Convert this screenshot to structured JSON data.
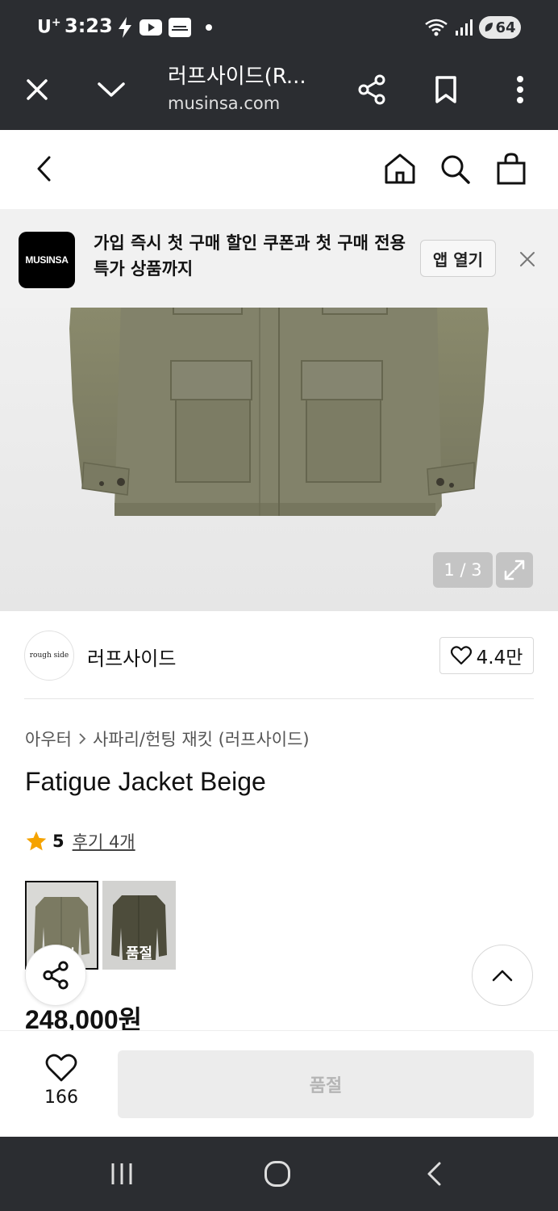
{
  "status_bar": {
    "carrier": "U",
    "carrier_sup": "+",
    "time": "3:23",
    "battery": "64",
    "icons": [
      "charging-icon",
      "youtube-icon",
      "app-icon",
      "wifi-icon",
      "signal-icon"
    ]
  },
  "browser": {
    "title": "러프사이드(R...",
    "url": "musinsa.com"
  },
  "banner": {
    "logo_text": "MUSINSA",
    "message": "가입 즉시 첫 구매 할인 쿠폰과 첫 구매 전용 특가 상품까지",
    "open_app_label": "앱 열기"
  },
  "gallery": {
    "counter": "1 / 3"
  },
  "brand": {
    "logo_text": "rough side",
    "name": "러프사이드",
    "likes": "4.4만"
  },
  "product": {
    "breadcrumb": [
      "아우터",
      "사파리/헌팅 재킷 (러프사이드)"
    ],
    "title": "Fatigue Jacket Beige",
    "rating": "5",
    "reviews_label": "후기 4개",
    "options": [
      {
        "tag": "품절",
        "color": "#7b7a62"
      },
      {
        "tag": "품절",
        "color": "#4d4c3b"
      }
    ],
    "price": "248,000원"
  },
  "buy_bar": {
    "wish_count": "166",
    "buy_label": "품절"
  },
  "colors": {
    "dark_bar": "#2b2d31",
    "star": "#f5a300",
    "disabled_button": "#ececec"
  }
}
